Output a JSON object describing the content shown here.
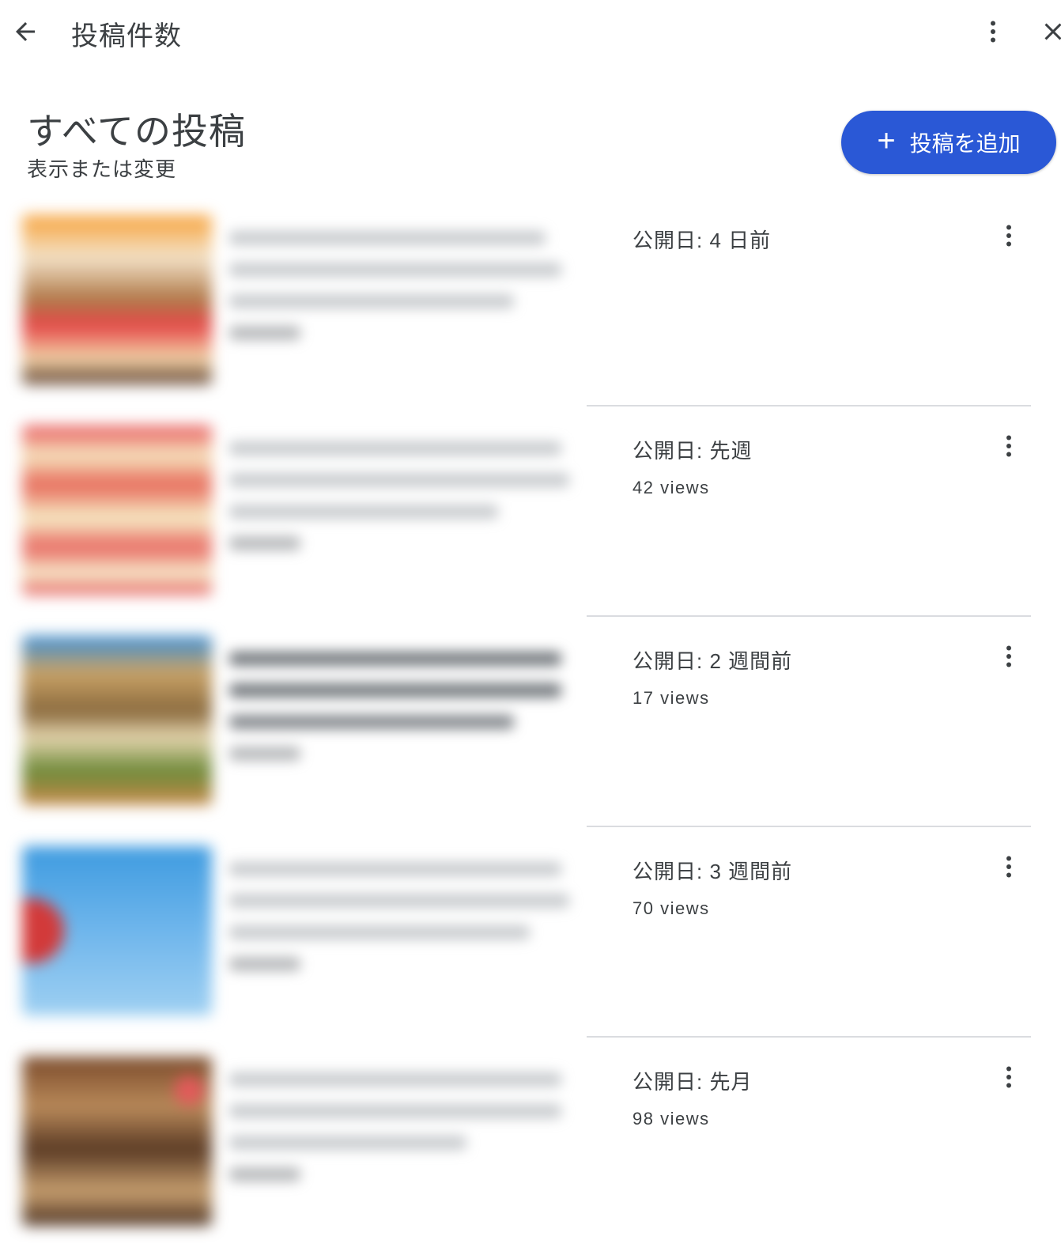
{
  "topbar": {
    "title": "投稿件数",
    "back_icon": "arrow-back-icon",
    "more_icon": "more-vert-icon",
    "close_icon": "close-icon"
  },
  "header": {
    "title": "すべての投稿",
    "subtitle": "表示または変更",
    "add_button_label": "投稿を追加",
    "accent_color": "#2a58d6"
  },
  "posts": [
    {
      "published": "公開日: 4 日前",
      "views": ""
    },
    {
      "published": "公開日: 先週",
      "views": "42 views"
    },
    {
      "published": "公開日: 2 週間前",
      "views": "17 views"
    },
    {
      "published": "公開日: 3 週間前",
      "views": "70 views"
    },
    {
      "published": "公開日: 先月",
      "views": "98 views"
    }
  ]
}
